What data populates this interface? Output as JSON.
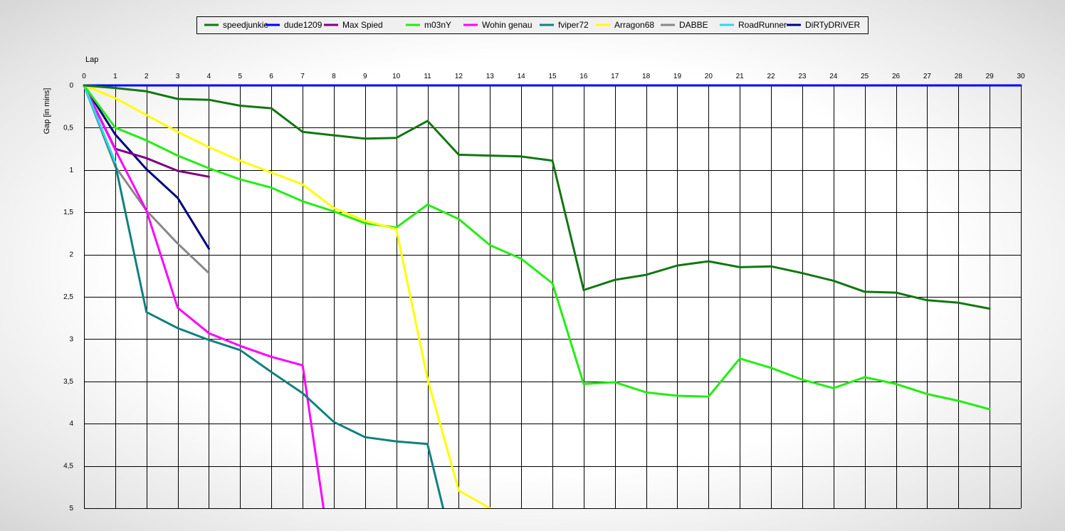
{
  "chart_data": {
    "type": "line",
    "xlabel": "Lap",
    "ylabel": "Gap [in mins]",
    "xlim": [
      0,
      30
    ],
    "ylim": [
      0,
      5
    ],
    "y_axis_inverted": true,
    "x_ticks": [
      "0",
      "1",
      "2",
      "3",
      "4",
      "5",
      "6",
      "7",
      "8",
      "9",
      "10",
      "11",
      "12",
      "13",
      "14",
      "15",
      "16",
      "17",
      "18",
      "19",
      "20",
      "21",
      "22",
      "23",
      "24",
      "25",
      "26",
      "27",
      "28",
      "29",
      "30"
    ],
    "y_ticks": [
      "0",
      "0,5",
      "1",
      "1,5",
      "2",
      "2,5",
      "3",
      "3,5",
      "4",
      "4,5",
      "5"
    ],
    "grid": true,
    "legend_position": "top-center",
    "series": [
      {
        "name": "speedjunkie",
        "color": "#117711",
        "x": [
          0,
          1,
          2,
          3,
          4,
          5,
          6,
          7,
          8,
          9,
          10,
          11,
          12,
          13,
          14,
          15,
          16,
          17,
          18,
          19,
          20,
          21,
          22,
          23,
          24,
          25,
          26,
          27,
          28,
          29
        ],
        "y": [
          0,
          0.03,
          0.07,
          0.16,
          0.17,
          0.24,
          0.27,
          0.55,
          0.59,
          0.63,
          0.62,
          0.42,
          0.82,
          0.83,
          0.84,
          0.89,
          2.42,
          2.3,
          2.24,
          2.13,
          2.08,
          2.15,
          2.14,
          2.22,
          2.31,
          2.44,
          2.45,
          2.54,
          2.57,
          2.64
        ]
      },
      {
        "name": "dude1209",
        "color": "#0000ff",
        "x": [
          0,
          30
        ],
        "y": [
          0,
          0
        ]
      },
      {
        "name": "Max Spied",
        "color": "#800080",
        "x": [
          0,
          1,
          2,
          3,
          4
        ],
        "y": [
          0,
          0.75,
          0.86,
          1.01,
          1.08
        ]
      },
      {
        "name": "m03nY",
        "color": "#22ee11",
        "x": [
          0,
          1,
          2,
          3,
          4,
          5,
          6,
          7,
          8,
          9,
          10,
          11,
          12,
          13,
          14,
          15,
          16,
          17,
          18,
          19,
          20,
          21,
          22,
          23,
          24,
          25,
          26,
          27,
          28,
          29
        ],
        "y": [
          0,
          0.5,
          0.65,
          0.83,
          0.98,
          1.11,
          1.21,
          1.37,
          1.49,
          1.63,
          1.68,
          1.41,
          1.58,
          1.89,
          2.05,
          2.34,
          3.53,
          3.51,
          3.63,
          3.67,
          3.68,
          3.23,
          3.34,
          3.48,
          3.58,
          3.45,
          3.53,
          3.65,
          3.73,
          3.83
        ]
      },
      {
        "name": "Wohin genau",
        "color": "#ff00ff",
        "x": [
          0,
          1,
          2,
          3,
          4,
          5,
          6,
          7,
          7.67
        ],
        "y": [
          0,
          0.76,
          1.48,
          2.63,
          2.93,
          3.08,
          3.21,
          3.31,
          5.0
        ]
      },
      {
        "name": "fviper72",
        "color": "#118080",
        "x": [
          0,
          1,
          2,
          3,
          4,
          5,
          6,
          7,
          8,
          9,
          10,
          11,
          11.5
        ],
        "y": [
          0,
          0.93,
          2.68,
          2.87,
          3.01,
          3.13,
          3.39,
          3.64,
          3.98,
          4.16,
          4.21,
          4.24,
          5.0
        ]
      },
      {
        "name": "Arragon68",
        "color": "#ffff00",
        "x": [
          0,
          1,
          2,
          3,
          4,
          5,
          6,
          7,
          8,
          9,
          10,
          11,
          12,
          13
        ],
        "y": [
          0,
          0.15,
          0.35,
          0.55,
          0.73,
          0.89,
          1.03,
          1.17,
          1.45,
          1.6,
          1.7,
          3.47,
          4.79,
          5.0
        ]
      },
      {
        "name": "DABBE",
        "color": "#888888",
        "x": [
          0,
          1,
          2,
          3,
          4
        ],
        "y": [
          0,
          0.96,
          1.48,
          1.87,
          2.22
        ]
      },
      {
        "name": "RoadRunner",
        "color": "#22ddee",
        "x": [
          0,
          1
        ],
        "y": [
          0,
          0.91
        ]
      },
      {
        "name": "DiRTyDRiVER",
        "color": "#000080",
        "x": [
          0,
          1,
          2,
          3,
          4
        ],
        "y": [
          0,
          0.58,
          0.99,
          1.33,
          1.93
        ]
      }
    ]
  }
}
